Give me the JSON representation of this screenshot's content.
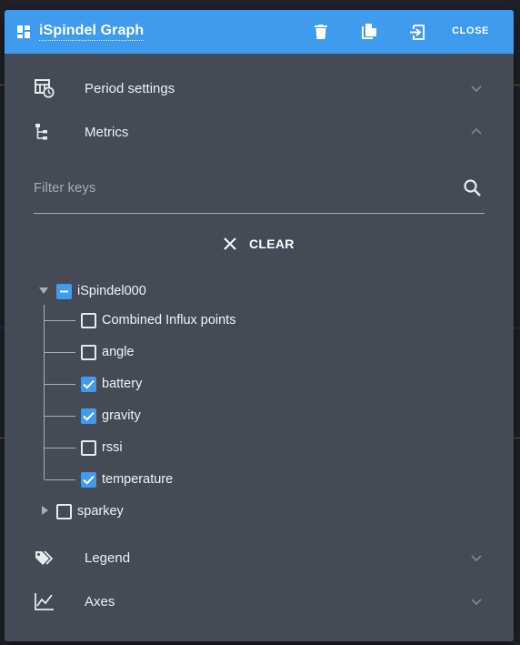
{
  "window": {
    "title": "iSpindel Graph",
    "close_label": "CLOSE"
  },
  "colors": {
    "accent": "#3e9bed",
    "panel": "#444b55",
    "text": "#eef0f3"
  },
  "sections": {
    "period": {
      "label": "Period settings",
      "icon": "calendar-clock-icon",
      "expanded": false
    },
    "metrics": {
      "label": "Metrics",
      "icon": "tree-structure-icon",
      "expanded": true
    },
    "legend": {
      "label": "Legend",
      "icon": "tags-icon",
      "expanded": false
    },
    "axes": {
      "label": "Axes",
      "icon": "line-chart-icon",
      "expanded": false
    }
  },
  "filter": {
    "placeholder": "Filter keys",
    "value": ""
  },
  "clear_label": "CLEAR",
  "tree": {
    "root": {
      "label": "iSpindel000",
      "state": "partial",
      "expanded": true
    },
    "children": [
      {
        "label": "Combined Influx points",
        "checked": false
      },
      {
        "label": "angle",
        "checked": false
      },
      {
        "label": "battery",
        "checked": true
      },
      {
        "label": "gravity",
        "checked": true
      },
      {
        "label": "rssi",
        "checked": false
      },
      {
        "label": "temperature",
        "checked": true
      }
    ],
    "second": {
      "label": "sparkey",
      "state": "unchecked",
      "expanded": false
    }
  }
}
